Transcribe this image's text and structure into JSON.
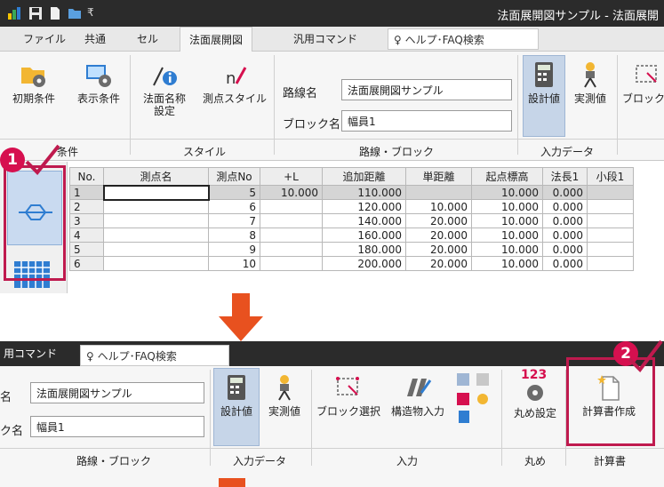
{
  "window": {
    "title": "法面展開図サンプル - 法面展開"
  },
  "tabs": {
    "file": "ファイル",
    "common": "共通",
    "cell": "セル",
    "slope": "法面展開図",
    "general": "汎用コマンド",
    "help_placeholder": "ヘルプ･FAQ検索"
  },
  "ribbon": {
    "initial_conditions": "初期条件",
    "display_conditions": "表示条件",
    "slope_name_line1": "法面名称",
    "slope_name_line2": "設定",
    "point_style": "測点スタイル",
    "route_label": "路線名",
    "route_value": "法面展開図サンプル",
    "block_label": "ブロック名",
    "block_value": "幅員1",
    "design_value": "設計値",
    "measured_value": "実測値",
    "block_select_partial": "ブロック選",
    "block_select": "ブロック選択",
    "structure_input": "構造物入力",
    "rounding_setting": "丸め設定",
    "report_create": "計算書作成",
    "group_conditions": "条件",
    "group_style": "スタイル",
    "group_route_block": "路線・ブロック",
    "group_input_data": "入力データ",
    "group_input": "入力",
    "group_rounding": "丸め",
    "group_report": "計算書"
  },
  "tabs2": {
    "general_partial": "用コマンド",
    "help_placeholder": "ヘルプ･FAQ検索"
  },
  "ribbon2": {
    "route_label_partial": "名",
    "block_label_partial": "ク名"
  },
  "table": {
    "headers": [
      "No.",
      "測点名",
      "測点No",
      "+L",
      "追加距離",
      "単距離",
      "起点標高",
      "法長1",
      "小段1"
    ],
    "rows": [
      [
        "1",
        "",
        "5",
        "10.000",
        "110.000",
        "",
        "10.000",
        "0.000",
        ""
      ],
      [
        "2",
        "",
        "6",
        "",
        "120.000",
        "10.000",
        "10.000",
        "0.000",
        ""
      ],
      [
        "3",
        "",
        "7",
        "",
        "140.000",
        "20.000",
        "10.000",
        "0.000",
        ""
      ],
      [
        "4",
        "",
        "8",
        "",
        "160.000",
        "20.000",
        "10.000",
        "0.000",
        ""
      ],
      [
        "5",
        "",
        "9",
        "",
        "180.000",
        "20.000",
        "10.000",
        "0.000",
        ""
      ],
      [
        "6",
        "",
        "10",
        "",
        "200.000",
        "20.000",
        "10.000",
        "0.000",
        ""
      ]
    ]
  },
  "badges": {
    "step1": "1",
    "step2": "2"
  },
  "colors": {
    "badge": "#d6104f",
    "arrow": "#e8511f",
    "highlight": "#bf1a4e"
  }
}
